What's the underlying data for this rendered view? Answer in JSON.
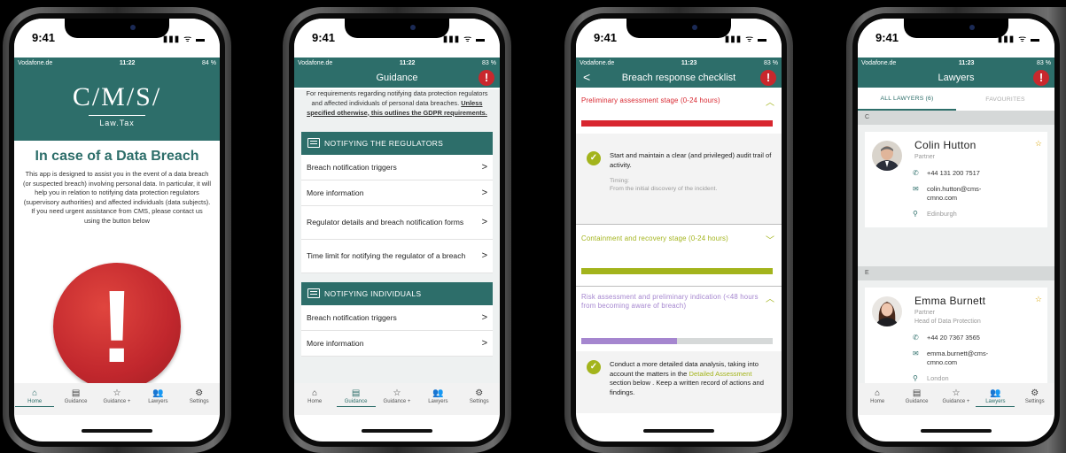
{
  "common": {
    "ios_time": "9:41",
    "ios_icons": "▮▮▮ ᯤ ▬",
    "carrier": "Vodafone.de",
    "alert_glyph": "!",
    "back_glyph": "<",
    "chevron_glyph": ">",
    "tabs": [
      {
        "icon": "⌂",
        "label": "Home"
      },
      {
        "icon": "▤",
        "label": "Guidance"
      },
      {
        "icon": "☆",
        "label": "Guidance +"
      },
      {
        "icon": "👥",
        "label": "Lawyers"
      },
      {
        "icon": "⚙",
        "label": "Settings"
      }
    ]
  },
  "screen1": {
    "clock": "11:22",
    "battery": "84 %",
    "logo": "C/M/S/",
    "logo_sub": "Law.Tax",
    "title": "In case of a Data Breach",
    "body": "This app is designed to assist you in the event of a data breach (or suspected breach) involving personal data. In particular, it will help you in relation to notifying data protection regulators (supervisory authorities) and affected individuals (data subjects). If you need urgent assistance from CMS, please contact us using the button below",
    "big_alert": "!"
  },
  "screen2": {
    "clock": "11:22",
    "battery": "83 %",
    "header": "Guidance",
    "intro_main": "For requirements regarding notifying data protection regulators and affected individuals of personal data breaches.",
    "intro_bold": "Unless specified otherwise, this outlines the GDPR requirements.",
    "section1": "NOTIFYING THE REGULATORS",
    "section1_items": [
      "Breach notification triggers",
      "More information",
      "Regulator details and breach notification forms",
      "Time limit for notifying the regulator of a breach"
    ],
    "section2": "NOTIFYING INDIVIDUALS",
    "section2_items": [
      "Breach notification triggers",
      "More information"
    ]
  },
  "screen3": {
    "clock": "11:23",
    "battery": "83 %",
    "header": "Breach response checklist",
    "stage1": "Preliminary assessment stage (0-24 hours)",
    "stage1_progress": 1.0,
    "item1": "Start and maintain a clear (and privileged) audit trail of activity.",
    "timing_label": "Timing:",
    "timing_value": "From the initial discovery of the incident.",
    "stage2": "Containment and recovery stage (0-24 hours)",
    "stage2_progress": 1.0,
    "stage3": "Risk assessment and preliminary indication (<48 hours from becoming aware of breach)",
    "stage3_progress": 0.5,
    "item2_a": "Conduct a more detailed data analysis, taking into account the matters in the",
    "item2_link": "Detailed Assessment",
    "item2_b": "section below . Keep a written record of actions and findings.",
    "colors": {
      "stage1": "#d8262f",
      "stage2": "#a3b41c",
      "stage3": "#a586cf"
    }
  },
  "screen4": {
    "clock": "11:23",
    "battery": "83 %",
    "header": "Lawyers",
    "tab_all": "ALL LAWYERS (6)",
    "tab_fav": "FAVOURITES",
    "group1": "C",
    "group2": "E",
    "lawyers": [
      {
        "name": "Colin Hutton",
        "role": "Partner",
        "role2": "",
        "phone": "+44 131 200 7517",
        "email": "colin.hutton@cms-cmno.com",
        "location": "Edinburgh"
      },
      {
        "name": "Emma Burnett",
        "role": "Partner",
        "role2": "Head of Data Protection",
        "phone": "+44 20 7367 3565",
        "email": "emma.burnett@cms-cmno.com",
        "location": "London"
      }
    ]
  }
}
